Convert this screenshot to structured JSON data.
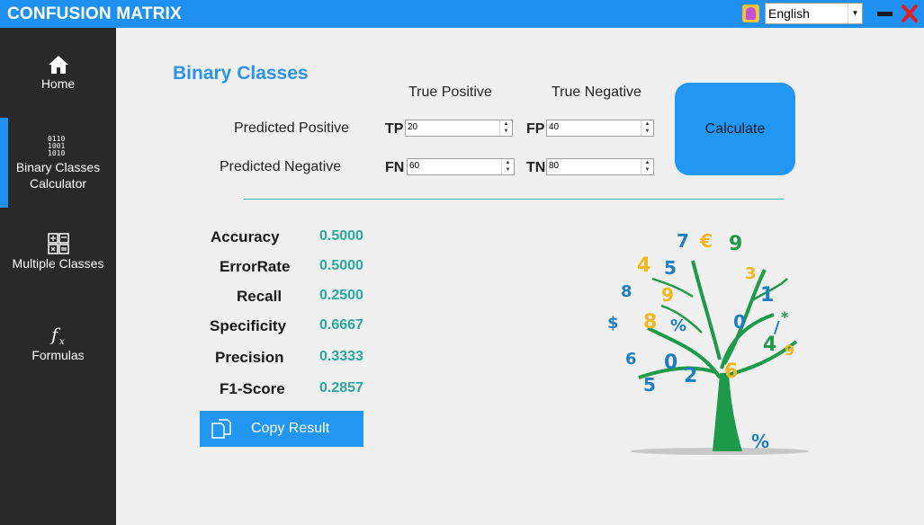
{
  "app": {
    "title": "CONFUSION MATRIX"
  },
  "titlebar": {
    "language": "English",
    "colors": {
      "bar": "#1e90f2",
      "close": "#e02020"
    }
  },
  "sidebar": {
    "items": [
      {
        "icon": "home-icon",
        "label": "Home"
      },
      {
        "icon": "binary-icon",
        "label": "Binary Classes Calculator",
        "active": true
      },
      {
        "icon": "grid-icon",
        "label": "Multiple Classes"
      },
      {
        "icon": "function-icon",
        "label": "Formulas"
      }
    ]
  },
  "main": {
    "heading": "Binary Classes",
    "columns": {
      "true_positive": "True Positive",
      "true_negative": "True Negative"
    },
    "rows": {
      "predicted_positive": "Predicted Positive",
      "predicted_negative": "Predicted Negative"
    },
    "inputs": {
      "tp": {
        "code": "TP",
        "value": "20"
      },
      "fp": {
        "code": "FP",
        "value": "40"
      },
      "fn": {
        "code": "FN",
        "value": "60"
      },
      "tn": {
        "code": "TN",
        "value": "80"
      }
    },
    "calculate_label": "Calculate",
    "metrics": [
      {
        "label": "Accuracy",
        "value": "0.5000"
      },
      {
        "label": "ErrorRate",
        "value": "0.5000"
      },
      {
        "label": "Recall",
        "value": "0.2500"
      },
      {
        "label": "Specificity",
        "value": "0.6667"
      },
      {
        "label": "Precision",
        "value": "0.3333"
      },
      {
        "label": "F1-Score",
        "value": "0.2857"
      }
    ],
    "copy_label": "Copy Result",
    "accent": "#2196f3",
    "value_color": "#2aa8a0"
  }
}
